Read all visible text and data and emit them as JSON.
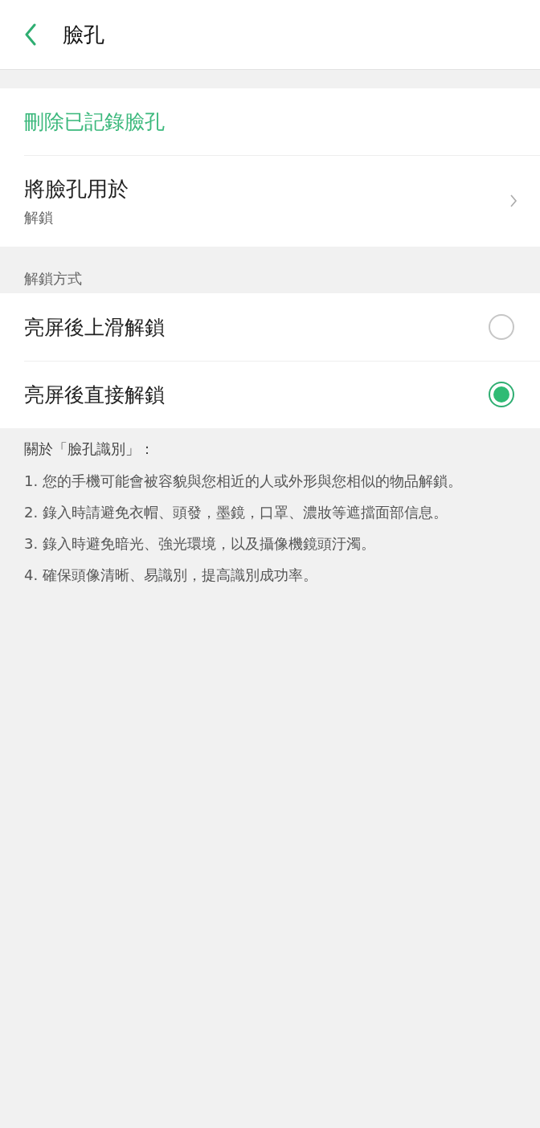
{
  "header": {
    "title": "臉孔"
  },
  "actions": [
    {
      "kind": "action",
      "label": "刪除已記錄臉孔"
    },
    {
      "kind": "link",
      "label": "將臉孔用於",
      "value": "解鎖"
    }
  ],
  "unlock_section": {
    "title": "解鎖方式",
    "options": [
      {
        "label": "亮屏後上滑解鎖",
        "selected": false
      },
      {
        "label": "亮屏後直接解鎖",
        "selected": true
      }
    ]
  },
  "notes": {
    "title": "關於「臉孔識別」：",
    "items": [
      "1. 您的手機可能會被容貌與您相近的人或外形與您相似的物品解鎖。",
      "2. 錄入時請避免衣帽、頭發，墨鏡，口罩、濃妝等遮擋面部信息。",
      "3. 錄入時避免暗光、強光環境，以及攝像機鏡頭汙濁。",
      "4. 確保頭像清晰、易識別，提高識別成功率。"
    ]
  }
}
